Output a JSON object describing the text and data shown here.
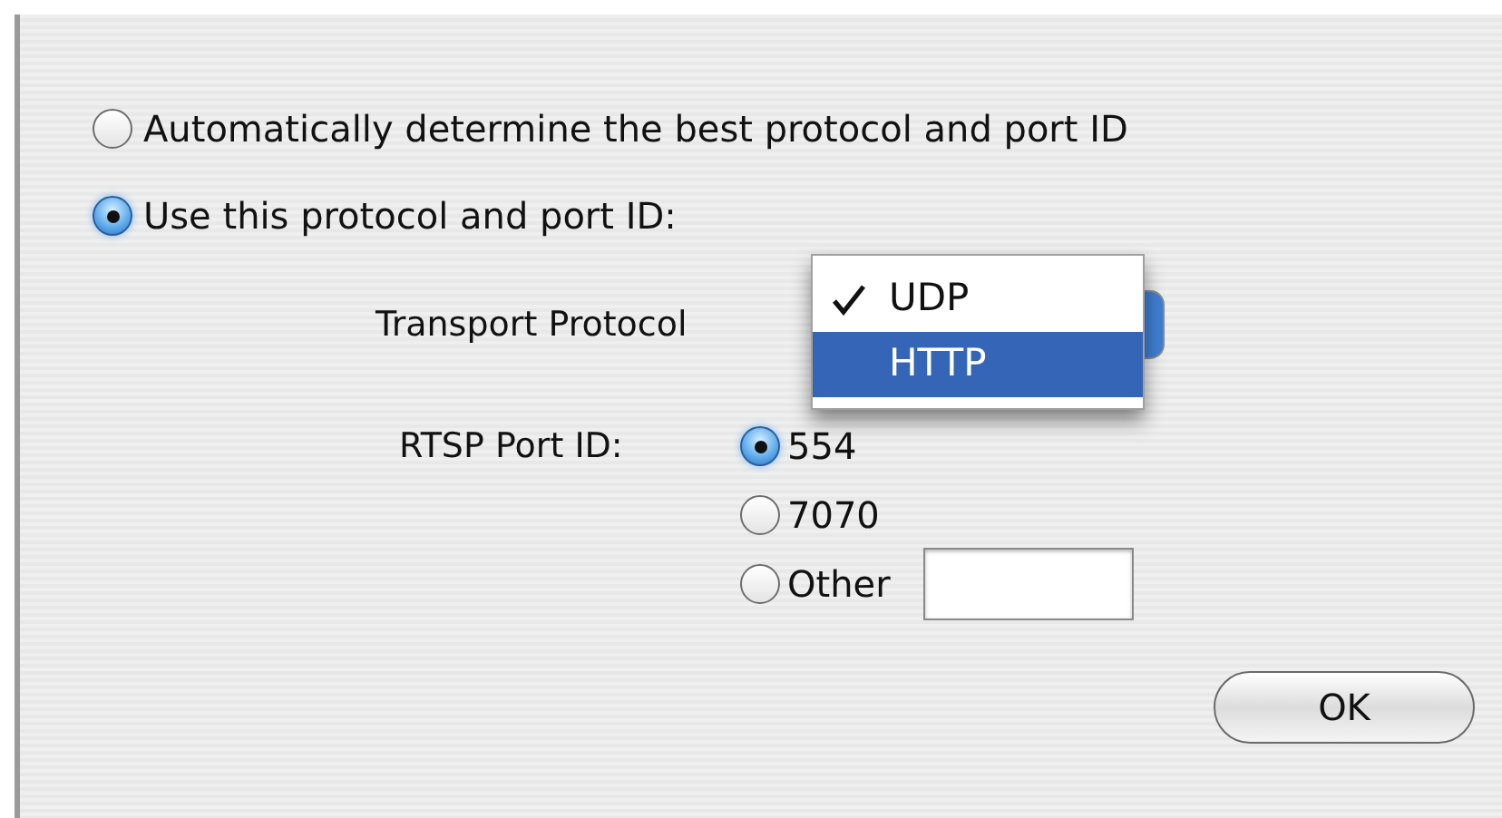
{
  "protocol_options": [
    {
      "label": "Automatically determine the best protocol and port ID",
      "selected": false
    },
    {
      "label": "Use this protocol and port ID:",
      "selected": true
    }
  ],
  "transport_protocol": {
    "label": "Transport Protocol",
    "menu": [
      {
        "label": "UDP",
        "checked": true,
        "highlighted": false
      },
      {
        "label": "HTTP",
        "checked": false,
        "highlighted": true
      }
    ]
  },
  "rtsp_port": {
    "label": "RTSP Port ID:",
    "options": [
      {
        "label": "554",
        "selected": true,
        "kind": "plain"
      },
      {
        "label": "7070",
        "selected": false,
        "kind": "plain"
      },
      {
        "label": "Other",
        "selected": false,
        "kind": "field"
      }
    ]
  },
  "ok_button": "OK"
}
